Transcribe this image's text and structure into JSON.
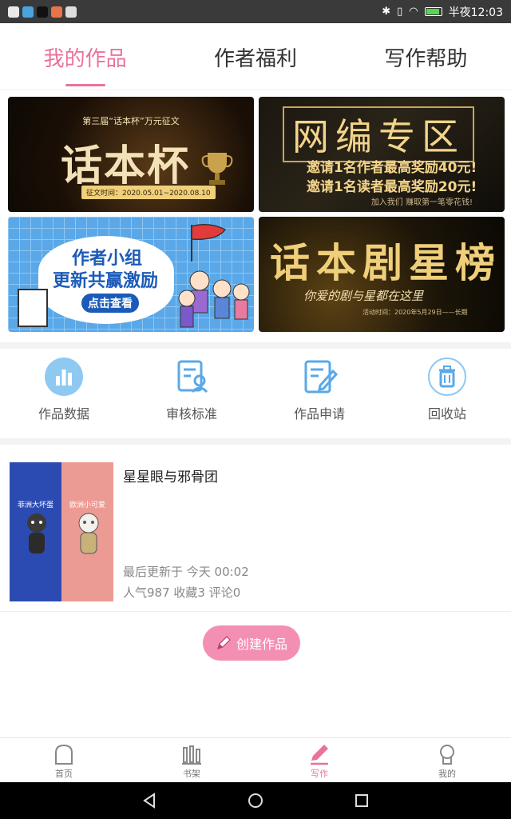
{
  "status_bar": {
    "time": "半夜12:03"
  },
  "tabs": [
    {
      "label": "我的作品",
      "active": true
    },
    {
      "label": "作者福利",
      "active": false
    },
    {
      "label": "写作帮助",
      "active": false
    }
  ],
  "banners": {
    "b1": {
      "small": "第三届“话本杯”万元征文",
      "title": "话本杯",
      "date": "征文时间：2020.05.01~2020.08.10"
    },
    "b2": {
      "title": "网编专区",
      "line1": "邀请1名作者最高奖励40元!",
      "line2": "邀请1名读者最高奖励20元!",
      "foot": "加入我们  赚取第一笔零花钱!"
    },
    "b3": {
      "line1": "作者小组",
      "line2": "更新共赢激励",
      "button": "点击查看"
    },
    "b4": {
      "title": "话本剧星榜",
      "sub": "你爱的剧与星都在这里",
      "date": "活动时间：2020年5月29日——长期"
    }
  },
  "tools": [
    {
      "label": "作品数据",
      "icon": "bar-chart-icon"
    },
    {
      "label": "审核标准",
      "icon": "review-doc-icon"
    },
    {
      "label": "作品申请",
      "icon": "edit-doc-icon"
    },
    {
      "label": "回收站",
      "icon": "trash-icon"
    }
  ],
  "work": {
    "cover_left": "菲洲大坏蛋",
    "cover_right": "欧洲小可爱",
    "title": "星星眼与邪骨团",
    "updated": "最后更新于 今天 00:02",
    "stats": "人气987 收藏3 评论0"
  },
  "create_button": "创建作品",
  "bottom_nav": [
    {
      "label": "首页",
      "icon": "home-icon",
      "active": false
    },
    {
      "label": "书架",
      "icon": "bookshelf-icon",
      "active": false
    },
    {
      "label": "写作",
      "icon": "pen-icon",
      "active": true
    },
    {
      "label": "我的",
      "icon": "profile-icon",
      "active": false
    }
  ],
  "colors": {
    "accent": "#e9739a",
    "create_button": "#f48fb4",
    "tool_icon": "#5aa8e8"
  }
}
